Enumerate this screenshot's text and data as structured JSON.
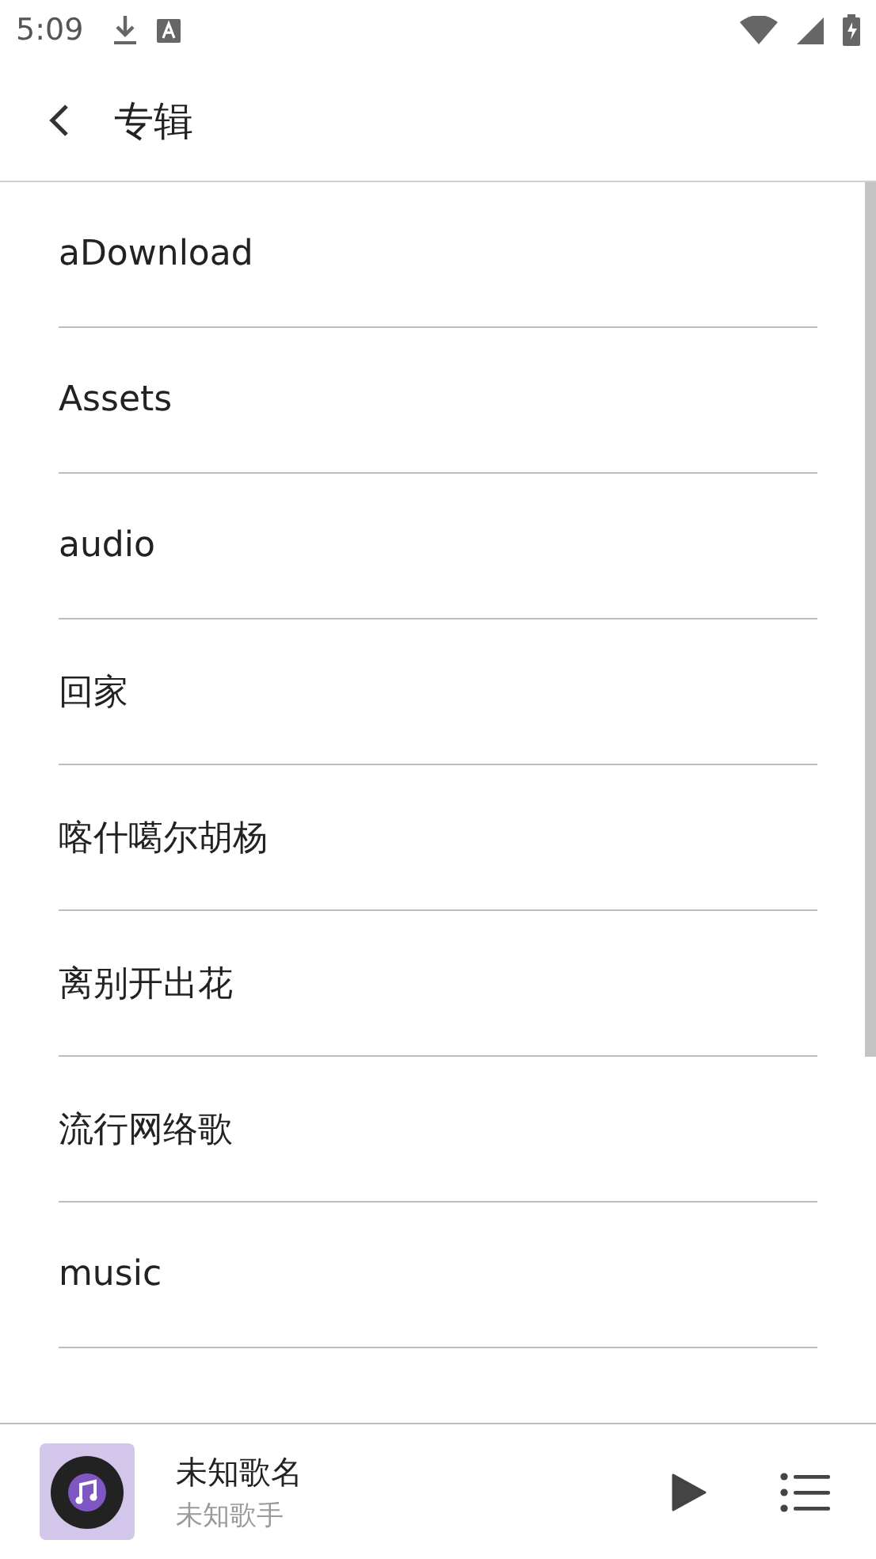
{
  "status_bar": {
    "time": "5:09"
  },
  "header": {
    "title": "专辑"
  },
  "albums": [
    {
      "name": "aDownload"
    },
    {
      "name": "Assets"
    },
    {
      "name": "audio"
    },
    {
      "name": "回家"
    },
    {
      "name": "喀什噶尔胡杨"
    },
    {
      "name": "离别开出花"
    },
    {
      "name": "流行网络歌"
    },
    {
      "name": "music"
    }
  ],
  "player": {
    "title": "未知歌名",
    "artist": "未知歌手"
  }
}
